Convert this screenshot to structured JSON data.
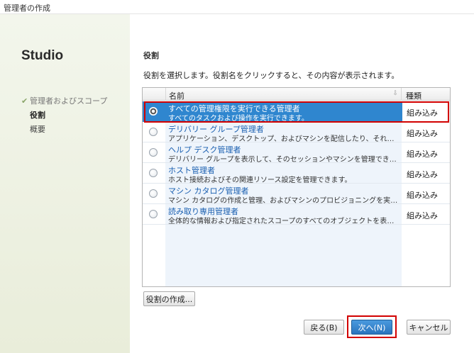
{
  "window": {
    "title": "管理者の作成"
  },
  "sidebar": {
    "app_title": "Studio",
    "steps": [
      {
        "label": "管理者およびスコープ",
        "state": "done"
      },
      {
        "label": "役割",
        "state": "current"
      },
      {
        "label": "概要",
        "state": "future"
      }
    ]
  },
  "main": {
    "section_title": "役割",
    "description": "役割を選択します。役割名をクリックすると、その内容が表示されます。",
    "table": {
      "columns": {
        "name": "名前",
        "type": "種類"
      },
      "rows": [
        {
          "name": "すべての管理権限を実行できる管理者",
          "desc": "すべてのタスクおよび操作を実行できます。",
          "type": "組み込み",
          "selected": true
        },
        {
          "name": "デリバリー グループ管理者",
          "desc": "アプリケーション、デスクトップ、およびマシンを配信したり、それらのセッションを管…",
          "type": "組み込み",
          "selected": false
        },
        {
          "name": "ヘルプ デスク管理者",
          "desc": "デリバリー グループを表示して、そのセッションやマシンを管理できます。",
          "type": "組み込み",
          "selected": false
        },
        {
          "name": "ホスト管理者",
          "desc": "ホスト接続およびその関連リソース設定を管理できます。",
          "type": "組み込み",
          "selected": false
        },
        {
          "name": "マシン カタログ管理者",
          "desc": "マシン カタログの作成と管理、およびマシンのプロビジョニングを実行できます。",
          "type": "組み込み",
          "selected": false
        },
        {
          "name": "読み取り専用管理者",
          "desc": "全体的な情報および指定されたスコープのすべてのオブジェクトを表示できますが…",
          "type": "組み込み",
          "selected": false
        }
      ]
    },
    "create_role_label": "役割の作成...",
    "buttons": {
      "back": "戻る(B)",
      "next": "次へ(N)",
      "cancel": "キャンセル"
    }
  },
  "colors": {
    "selection": "#2f86cf",
    "highlight_border": "#d20000",
    "link_text": "#1a5fb0",
    "sidebar_bg": "#eef2e2"
  }
}
